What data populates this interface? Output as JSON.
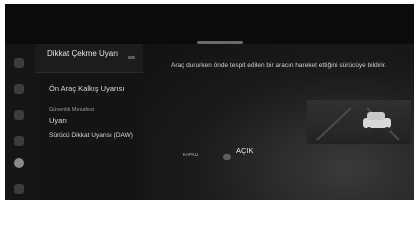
{
  "menu": {
    "title": "Dikkat Çekme Uyarı",
    "items": [
      {
        "label": "Ön Araç Kalkış Uyarısı"
      },
      {
        "label": "Güvenlik Mesafesi"
      },
      {
        "label": "Uyarı"
      },
      {
        "label": "Sürücü Dikkat Uyarısı (DAW)"
      }
    ]
  },
  "content": {
    "description": "Araç dururken önde tespit edilen bir aracın hareket ettiğini sürücüye bildirir.",
    "status_off": "KAPALI",
    "status_on": "AÇIK"
  },
  "icons": {
    "rail": [
      "home-icon",
      "nav-icon",
      "media-icon",
      "phone-icon",
      "settings-icon",
      "user-icon"
    ],
    "back": "back-icon"
  },
  "colors": {
    "background": "#101010",
    "panel": "#141414",
    "text": "#dcdcdc"
  }
}
